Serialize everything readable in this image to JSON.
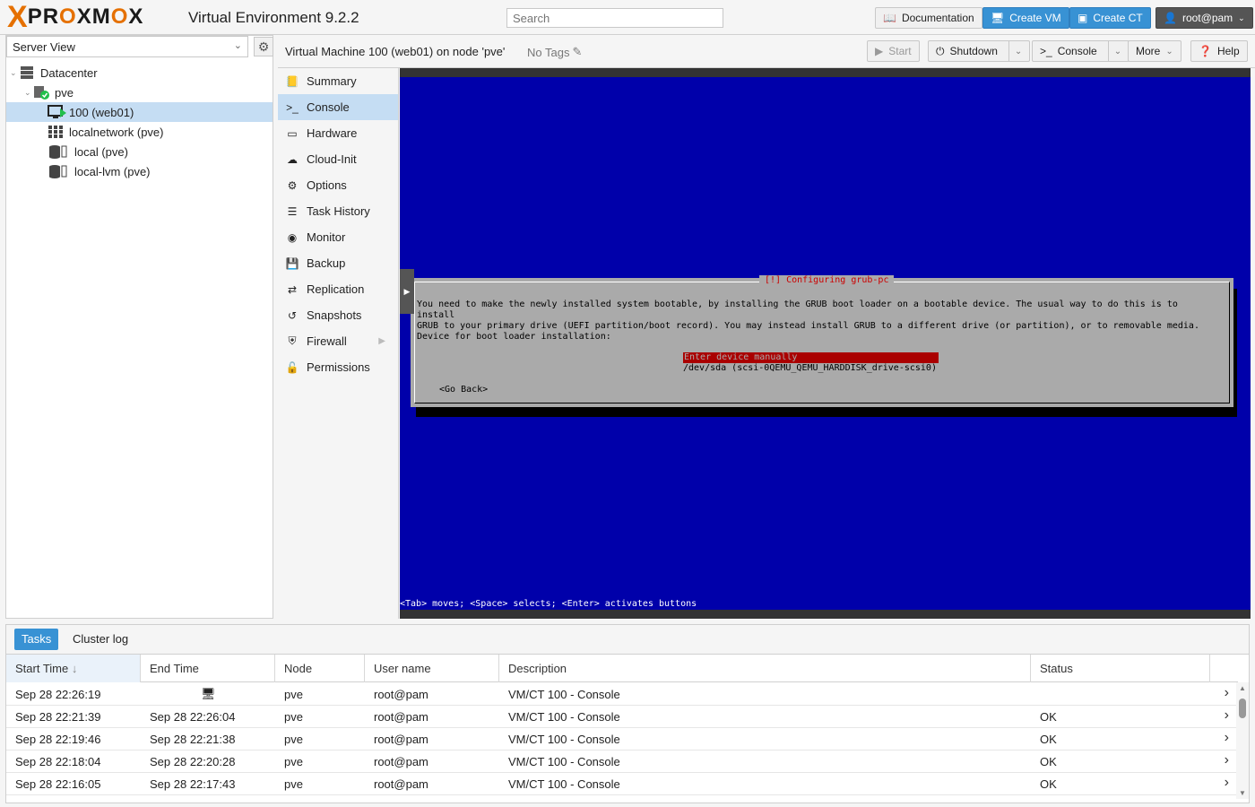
{
  "app": {
    "logo_x": "X",
    "logo_word_a": "PR",
    "logo_o1": "O",
    "logo_word_b": "XM",
    "logo_o2": "O",
    "logo_word_c": "X",
    "product": "Virtual Environment 9.2.2"
  },
  "search": {
    "placeholder": "Search"
  },
  "toolbar": {
    "documentation": "Documentation",
    "create_vm": "Create VM",
    "create_ct": "Create CT",
    "user": "root@pam"
  },
  "left": {
    "view": "Server View",
    "tree": [
      {
        "label": "Datacenter"
      },
      {
        "label": "pve"
      },
      {
        "label": "100 (web01)"
      },
      {
        "label": "localnetwork (pve)"
      },
      {
        "label": "local (pve)"
      },
      {
        "label": "local-lvm (pve)"
      }
    ]
  },
  "header": {
    "title": "Virtual Machine 100 (web01) on node 'pve'",
    "tags": "No Tags",
    "start": "Start",
    "shutdown": "Shutdown",
    "console": "Console",
    "more": "More",
    "help": "Help"
  },
  "menu": [
    {
      "label": "Summary",
      "icon": "book-icon"
    },
    {
      "label": "Console",
      "icon": "terminal-icon"
    },
    {
      "label": "Hardware",
      "icon": "monitor-icon"
    },
    {
      "label": "Cloud-Init",
      "icon": "cloud-icon"
    },
    {
      "label": "Options",
      "icon": "gear-icon"
    },
    {
      "label": "Task History",
      "icon": "list-icon"
    },
    {
      "label": "Monitor",
      "icon": "eye-icon"
    },
    {
      "label": "Backup",
      "icon": "floppy-icon"
    },
    {
      "label": "Replication",
      "icon": "retweet-icon"
    },
    {
      "label": "Snapshots",
      "icon": "history-icon"
    },
    {
      "label": "Firewall",
      "icon": "shield-icon"
    },
    {
      "label": "Permissions",
      "icon": "unlock-icon"
    }
  ],
  "console_screen": {
    "dialog_title": "[!] Configuring grub-pc",
    "body": "You need to make the newly installed system bootable, by installing the GRUB boot loader on a bootable device. The usual way to do this is to install\nGRUB to your primary drive (UEFI partition/boot record). You may instead install GRUB to a different drive (or partition), or to removable media.",
    "prompt": "Device for boot loader installation:",
    "option_selected": "Enter device manually",
    "option_2": "/dev/sda  (scsi-0QEMU_QEMU_HARDDISK_drive-scsi0)",
    "go_back": "<Go Back>",
    "status": "<Tab> moves; <Space> selects; <Enter> activates buttons"
  },
  "tasks": {
    "tab_tasks": "Tasks",
    "tab_cluster": "Cluster log",
    "columns": [
      "Start Time",
      "End Time",
      "Node",
      "User name",
      "Description",
      "Status"
    ],
    "rows": [
      {
        "start": "Sep 28 22:26:19",
        "end": "",
        "node": "pve",
        "user": "root@pam",
        "desc": "VM/CT 100 - Console",
        "status": ""
      },
      {
        "start": "Sep 28 22:21:39",
        "end": "Sep 28 22:26:04",
        "node": "pve",
        "user": "root@pam",
        "desc": "VM/CT 100 - Console",
        "status": "OK"
      },
      {
        "start": "Sep 28 22:19:46",
        "end": "Sep 28 22:21:38",
        "node": "pve",
        "user": "root@pam",
        "desc": "VM/CT 100 - Console",
        "status": "OK"
      },
      {
        "start": "Sep 28 22:18:04",
        "end": "Sep 28 22:20:28",
        "node": "pve",
        "user": "root@pam",
        "desc": "VM/CT 100 - Console",
        "status": "OK"
      },
      {
        "start": "Sep 28 22:16:05",
        "end": "Sep 28 22:17:43",
        "node": "pve",
        "user": "root@pam",
        "desc": "VM/CT 100 - Console",
        "status": "OK"
      }
    ]
  },
  "colors": {
    "accent": "#3892d4",
    "brand_orange": "#e57000",
    "console_bg": "#0000aa",
    "selection": "#c5ddf3"
  }
}
